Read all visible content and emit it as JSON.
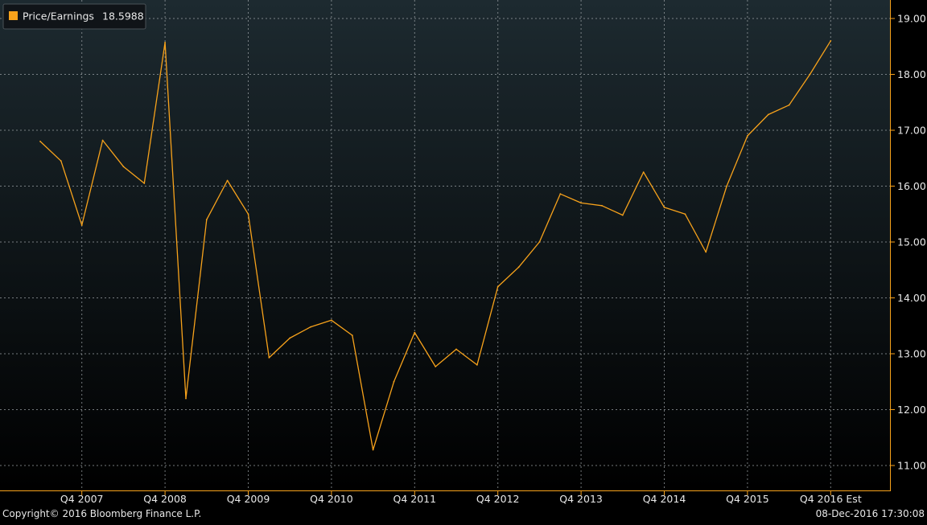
{
  "legend": {
    "label": "Price/Earnings",
    "value": "18.5988",
    "color": "#f7a21b"
  },
  "footer": {
    "copyright": "Copyright© 2016 Bloomberg Finance L.P.",
    "timestamp": "08-Dec-2016 17:30:08"
  },
  "colors": {
    "background_top": "#1d2a30",
    "background_bottom": "#000000",
    "line": "#f7a21b",
    "grid": "#9aa0a4",
    "axis": "#f7a21b",
    "text": "#e8e8e8"
  },
  "chart_data": {
    "type": "line",
    "title": "",
    "xlabel": "",
    "ylabel": "",
    "ylim": [
      10.6,
      19.3
    ],
    "y_axis_side": "right",
    "grid": true,
    "legend_position": "top-left",
    "x_tick_labels": [
      "Q4 2007",
      "Q4 2008",
      "Q4 2009",
      "Q4 2010",
      "Q4 2011",
      "Q4 2012",
      "Q4 2013",
      "Q4 2014",
      "Q4 2015",
      "Q4 2016 Est"
    ],
    "y_ticks": [
      11,
      12,
      13,
      14,
      15,
      16,
      17,
      18,
      19
    ],
    "y_tick_labels": [
      "11.00",
      "12.00",
      "13.00",
      "14.00",
      "15.00",
      "16.00",
      "17.00",
      "18.00",
      "19.00"
    ],
    "series": [
      {
        "name": "Price/Earnings",
        "x": [
          2007.5,
          2007.75,
          2008.0,
          2008.25,
          2008.5,
          2008.75,
          2009.0,
          2009.25,
          2009.5,
          2009.75,
          2010.0,
          2010.25,
          2010.5,
          2010.75,
          2011.0,
          2011.25,
          2011.5,
          2011.75,
          2012.0,
          2012.25,
          2012.5,
          2012.75,
          2013.0,
          2013.25,
          2013.5,
          2013.75,
          2014.0,
          2014.25,
          2014.5,
          2014.75,
          2015.0,
          2015.25,
          2015.5,
          2015.75,
          2016.0,
          2016.25,
          2016.5,
          2016.75,
          2017.0
        ],
        "values": [
          16.8,
          16.45,
          15.3,
          16.82,
          16.35,
          16.05,
          18.57,
          12.2,
          15.4,
          16.1,
          15.5,
          12.93,
          13.28,
          13.48,
          13.6,
          13.33,
          11.28,
          12.5,
          13.38,
          12.77,
          13.08,
          12.8,
          14.2,
          14.55,
          15.0,
          15.86,
          15.7,
          15.65,
          15.48,
          16.25,
          15.62,
          15.5,
          14.82,
          16.0,
          16.9,
          17.28,
          17.45,
          18.0,
          18.6
        ]
      }
    ]
  }
}
